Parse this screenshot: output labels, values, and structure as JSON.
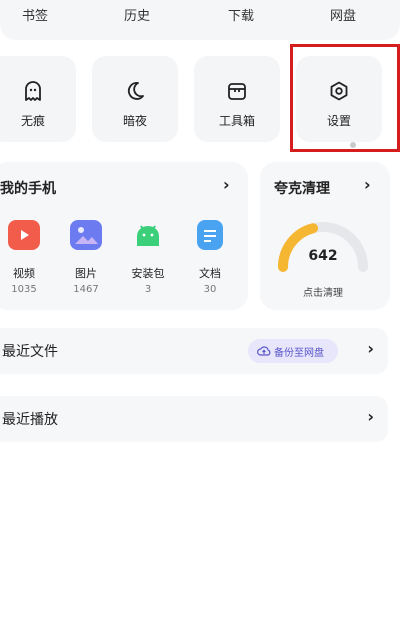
{
  "topnav": [
    "书签",
    "历史",
    "下载",
    "网盘"
  ],
  "tools": [
    {
      "label": "无痕",
      "icon": "ghost-icon"
    },
    {
      "label": "暗夜",
      "icon": "moon-icon"
    },
    {
      "label": "工具箱",
      "icon": "toolbox-icon"
    },
    {
      "label": "设置",
      "icon": "settings-hexagon-icon"
    }
  ],
  "my_phone": {
    "title": "我的手机",
    "chevron": "›",
    "items": [
      {
        "name": "视频",
        "count": "1035",
        "icon": "video-icon",
        "color": "#f25c4a"
      },
      {
        "name": "图片",
        "count": "1467",
        "icon": "image-icon",
        "color": "#6d7bf0"
      },
      {
        "name": "安装包",
        "count": "3",
        "icon": "android-icon",
        "color": "#3ccf7a"
      },
      {
        "name": "文档",
        "count": "30",
        "icon": "document-icon",
        "color": "#4aa3f0"
      }
    ]
  },
  "clean": {
    "title": "夸克清理",
    "chevron": "›",
    "value": "642",
    "caption": "点击清理",
    "gauge_fraction": 0.42,
    "gauge_color": "#f5b731",
    "track_color": "#e6e7ea"
  },
  "recent_files": {
    "title": "最近文件",
    "backup_label": "备份至网盘",
    "chevron": "›"
  },
  "recent_play": {
    "title": "最近播放",
    "chevron": "›"
  }
}
